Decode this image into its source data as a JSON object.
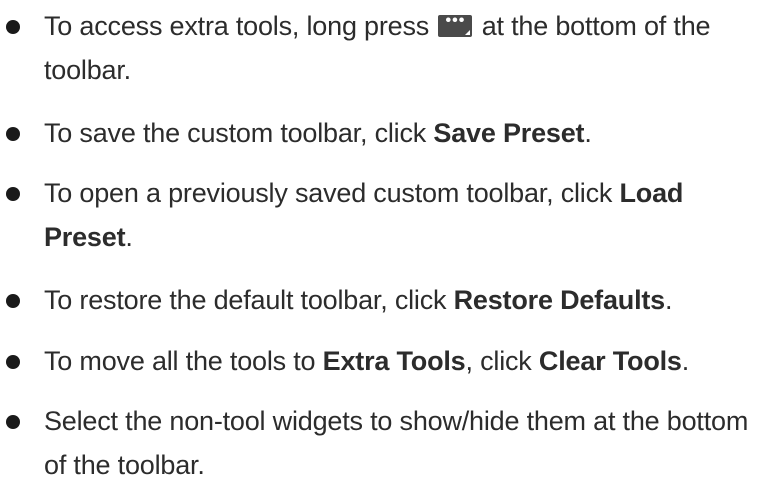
{
  "bullets": [
    {
      "before": "To access extra tools, long press ",
      "icon": "more-options-icon",
      "icon_glyph": "•••",
      "after": " at the bottom of the toolbar."
    },
    {
      "before": "To save the custom toolbar, click ",
      "bold": "Save Preset",
      "after": "."
    },
    {
      "before": "To open a previously saved custom toolbar, click ",
      "bold": "Load Preset",
      "after": "."
    },
    {
      "before": "To restore the default toolbar, click ",
      "bold": "Restore Defaults",
      "after": "."
    },
    {
      "before": "To move all the tools to ",
      "bold": "Extra Tools",
      "middle": ", click ",
      "bold2": "Clear Tools",
      "after": "."
    },
    {
      "before": "Select the non-tool widgets to show/hide them at the bottom of the toolbar."
    }
  ]
}
